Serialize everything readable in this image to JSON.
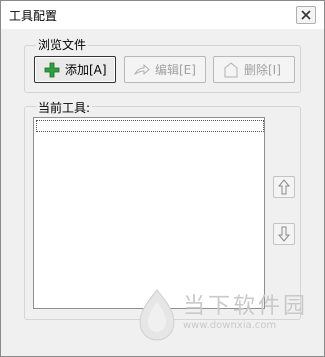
{
  "window": {
    "title": "工具配置"
  },
  "browse": {
    "group_label": "浏览文件",
    "add_label": "添加[A]",
    "edit_label": "编辑[E]",
    "delete_label": "删除[I]"
  },
  "tools": {
    "group_label": "当前工具:",
    "items": []
  },
  "watermark": {
    "text": "当下软件园",
    "url": "www.downxia.com"
  },
  "colors": {
    "add_icon": "#2ea043",
    "disabled_text": "#a0a0a0",
    "watermark": "#c9c9c9"
  }
}
